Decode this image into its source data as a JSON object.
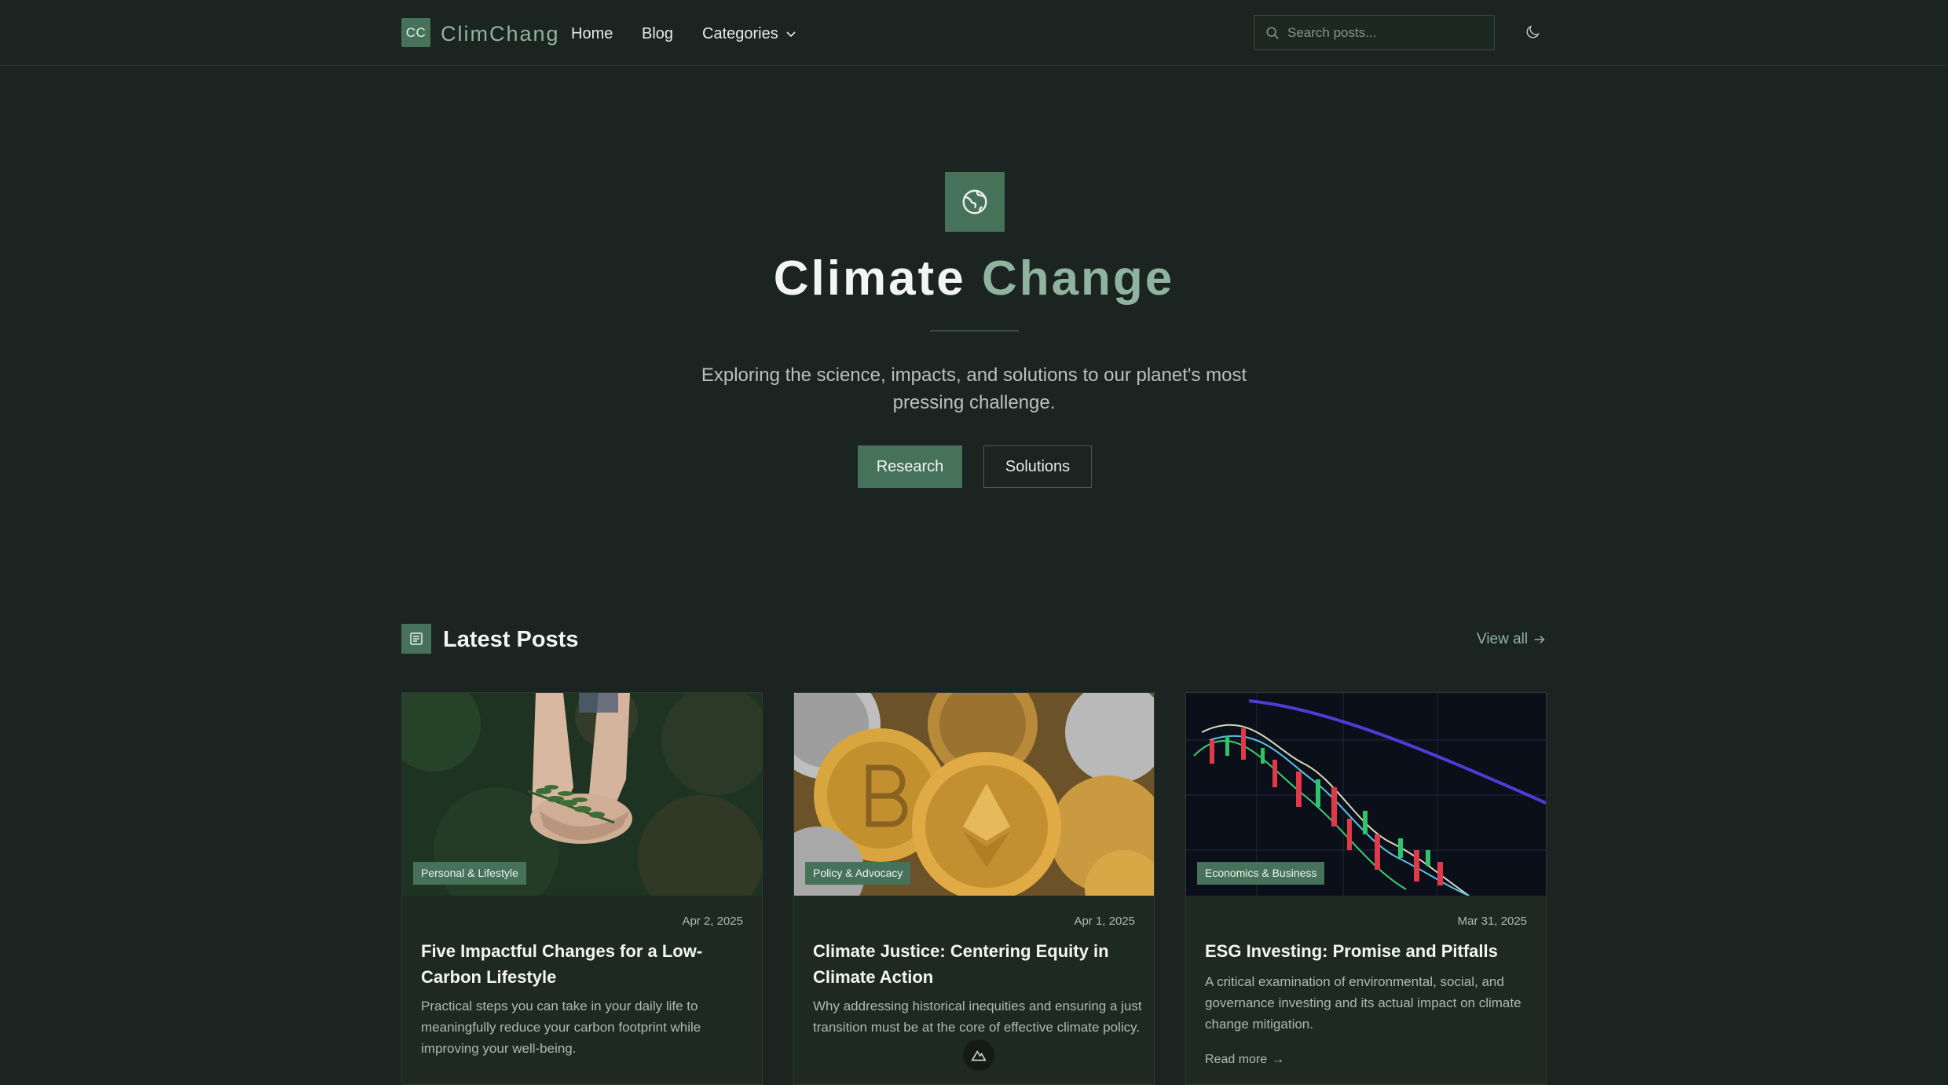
{
  "brand": {
    "logo_text": "CC",
    "name": "ClimChang"
  },
  "nav": {
    "home": "Home",
    "blog": "Blog",
    "categories": "Categories"
  },
  "search": {
    "placeholder": "Search posts..."
  },
  "hero": {
    "title_main": "Climate",
    "title_accent": "Change",
    "subtitle": "Exploring the science, impacts, and solutions to our planet's most pressing challenge.",
    "primary_button": "Research",
    "secondary_button": "Solutions"
  },
  "latest": {
    "title": "Latest Posts",
    "view_all": "View all",
    "posts": [
      {
        "category": "Personal & Lifestyle",
        "date": "Apr 2, 2025",
        "title": "Five Impactful Changes for a Low-Carbon Lifestyle",
        "excerpt": "Practical steps you can take in your daily life to meaningfully reduce your carbon footprint while improving your well-being."
      },
      {
        "category": "Policy & Advocacy",
        "date": "Apr 1, 2025",
        "title": "Climate Justice: Centering Equity in Climate Action",
        "excerpt": "Why addressing historical inequities and ensuring a just transition must be at the core of effective climate policy."
      },
      {
        "category": "Economics & Business",
        "date": "Mar 31, 2025",
        "title": "ESG Investing: Promise and Pitfalls",
        "excerpt": "A critical examination of environmental, social, and governance investing and its actual impact on climate change mitigation.",
        "read_more": "Read more"
      }
    ]
  },
  "colors": {
    "accent": "#47725a",
    "accent_text": "#8fb39f",
    "background": "#1b2420",
    "card": "#1f2924"
  }
}
